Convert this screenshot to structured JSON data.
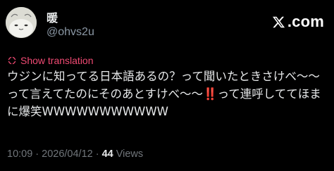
{
  "author": {
    "display_name": "暖",
    "handle": "@ohvs2u"
  },
  "brand": {
    "logo_icon": "x-logo-icon",
    "text": ".com"
  },
  "translation": {
    "icon": "translate-icon",
    "label": "Show translation"
  },
  "tweet": {
    "text": "ウジンに知ってる日本語あるの？って聞いたときさけべ〜〜って言えてたのにそのあとすけべ〜〜‼️って連呼しててほまに爆笑WWWWWWWWWWW"
  },
  "meta": {
    "time": "10:09",
    "separator1": "·",
    "date": "2026/04/12",
    "separator2": "·",
    "views_count": "44",
    "views_label": "Views"
  },
  "colors": {
    "background": "#000000",
    "accent": "#f04a73",
    "primary_text": "#e7e9ea",
    "secondary_text": "#71767b"
  }
}
